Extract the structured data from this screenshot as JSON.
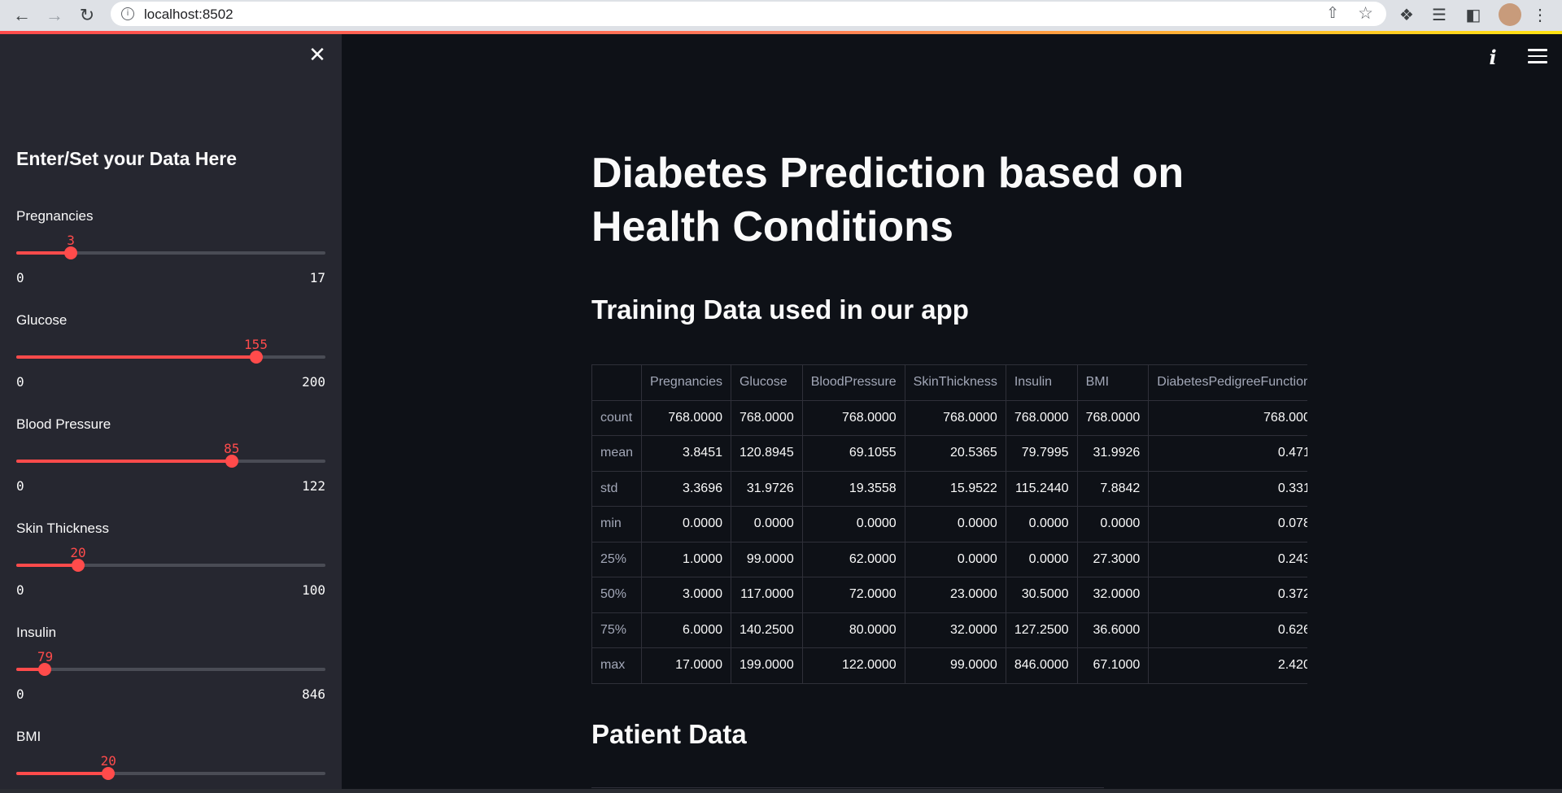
{
  "browser": {
    "url": "localhost:8502"
  },
  "sidebar": {
    "title": "Enter/Set your Data Here",
    "sliders": [
      {
        "label": "Pregnancies",
        "value": "3",
        "min": "0",
        "max": "17",
        "fraction": 0.1765
      },
      {
        "label": "Glucose",
        "value": "155",
        "min": "0",
        "max": "200",
        "fraction": 0.775
      },
      {
        "label": "Blood Pressure",
        "value": "85",
        "min": "0",
        "max": "122",
        "fraction": 0.6967
      },
      {
        "label": "Skin Thickness",
        "value": "20",
        "min": "0",
        "max": "100",
        "fraction": 0.2
      },
      {
        "label": "Insulin",
        "value": "79",
        "min": "0",
        "max": "846",
        "fraction": 0.0934
      },
      {
        "label": "BMI",
        "value": "20",
        "min": "",
        "max": "",
        "fraction": 0.298
      }
    ]
  },
  "main": {
    "title": "Diabetes Prediction based on Health Conditions",
    "training_header": "Training Data used in our app",
    "patient_header": "Patient Data",
    "table": {
      "columns": [
        "",
        "Pregnancies",
        "Glucose",
        "BloodPressure",
        "SkinThickness",
        "Insulin",
        "BMI",
        "DiabetesPedigreeFunction"
      ],
      "rows": [
        [
          "count",
          "768.0000",
          "768.0000",
          "768.0000",
          "768.0000",
          "768.0000",
          "768.0000",
          "768.000"
        ],
        [
          "mean",
          "3.8451",
          "120.8945",
          "69.1055",
          "20.5365",
          "79.7995",
          "31.9926",
          "0.471"
        ],
        [
          "std",
          "3.3696",
          "31.9726",
          "19.3558",
          "15.9522",
          "115.2440",
          "7.8842",
          "0.331"
        ],
        [
          "min",
          "0.0000",
          "0.0000",
          "0.0000",
          "0.0000",
          "0.0000",
          "0.0000",
          "0.078"
        ],
        [
          "25%",
          "1.0000",
          "99.0000",
          "62.0000",
          "0.0000",
          "0.0000",
          "27.3000",
          "0.243"
        ],
        [
          "50%",
          "3.0000",
          "117.0000",
          "72.0000",
          "23.0000",
          "30.5000",
          "32.0000",
          "0.372"
        ],
        [
          "75%",
          "6.0000",
          "140.2500",
          "80.0000",
          "32.0000",
          "127.2500",
          "36.6000",
          "0.626"
        ],
        [
          "max",
          "17.0000",
          "199.0000",
          "122.0000",
          "99.0000",
          "846.0000",
          "67.1000",
          "2.420"
        ]
      ]
    }
  },
  "colors": {
    "accent": "#ff4b4b",
    "background": "#0e1117",
    "sidebar": "#262730",
    "text": "#fafafa"
  }
}
